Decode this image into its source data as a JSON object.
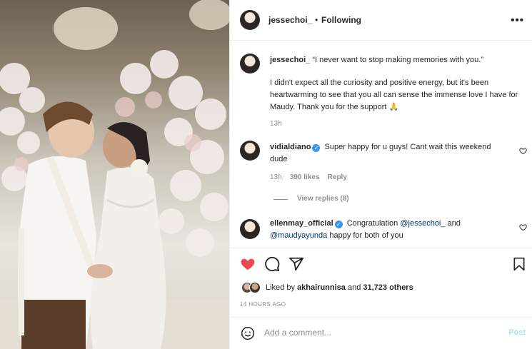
{
  "header": {
    "username": "jessechoi_",
    "separator": "•",
    "follow_status": "Following",
    "more_icon": "more-horizontal-icon"
  },
  "caption": {
    "username": "jessechoi_",
    "headline": "“I never want to stop making memories with you.”",
    "body": "I didn't expect all the curiosity and positive energy, but it's been heartwarming to see that you all can sense the immense love I have for Maudy. Thank you for the support",
    "emoji": "🙏",
    "time": "13h"
  },
  "comments": [
    {
      "username": "vidialdiano",
      "verified": true,
      "text": "Super happy for u guys! Cant wait this weekend dude",
      "time": "13h",
      "likes": "390 likes",
      "reply": "Reply",
      "view_replies": "View replies (8)"
    },
    {
      "username": "ellenmay_official",
      "verified": true,
      "text_pre": "Congratulation",
      "mention1": "@jessechoi_",
      "text_mid": "and",
      "mention2": "@maudyayunda",
      "text_post": "happy for both of you"
    }
  ],
  "actions": {
    "liked": true,
    "like_color": "#ed4956",
    "icons": [
      "heart-icon",
      "comment-icon",
      "share-icon",
      "bookmark-icon"
    ]
  },
  "likes": {
    "prefix": "Liked by",
    "user": "akhairunnisa",
    "conj": "and",
    "others": "31,723 others"
  },
  "timestamp": "14 HOURS AGO",
  "comment_box": {
    "placeholder": "Add a comment...",
    "post_label": "Post"
  }
}
